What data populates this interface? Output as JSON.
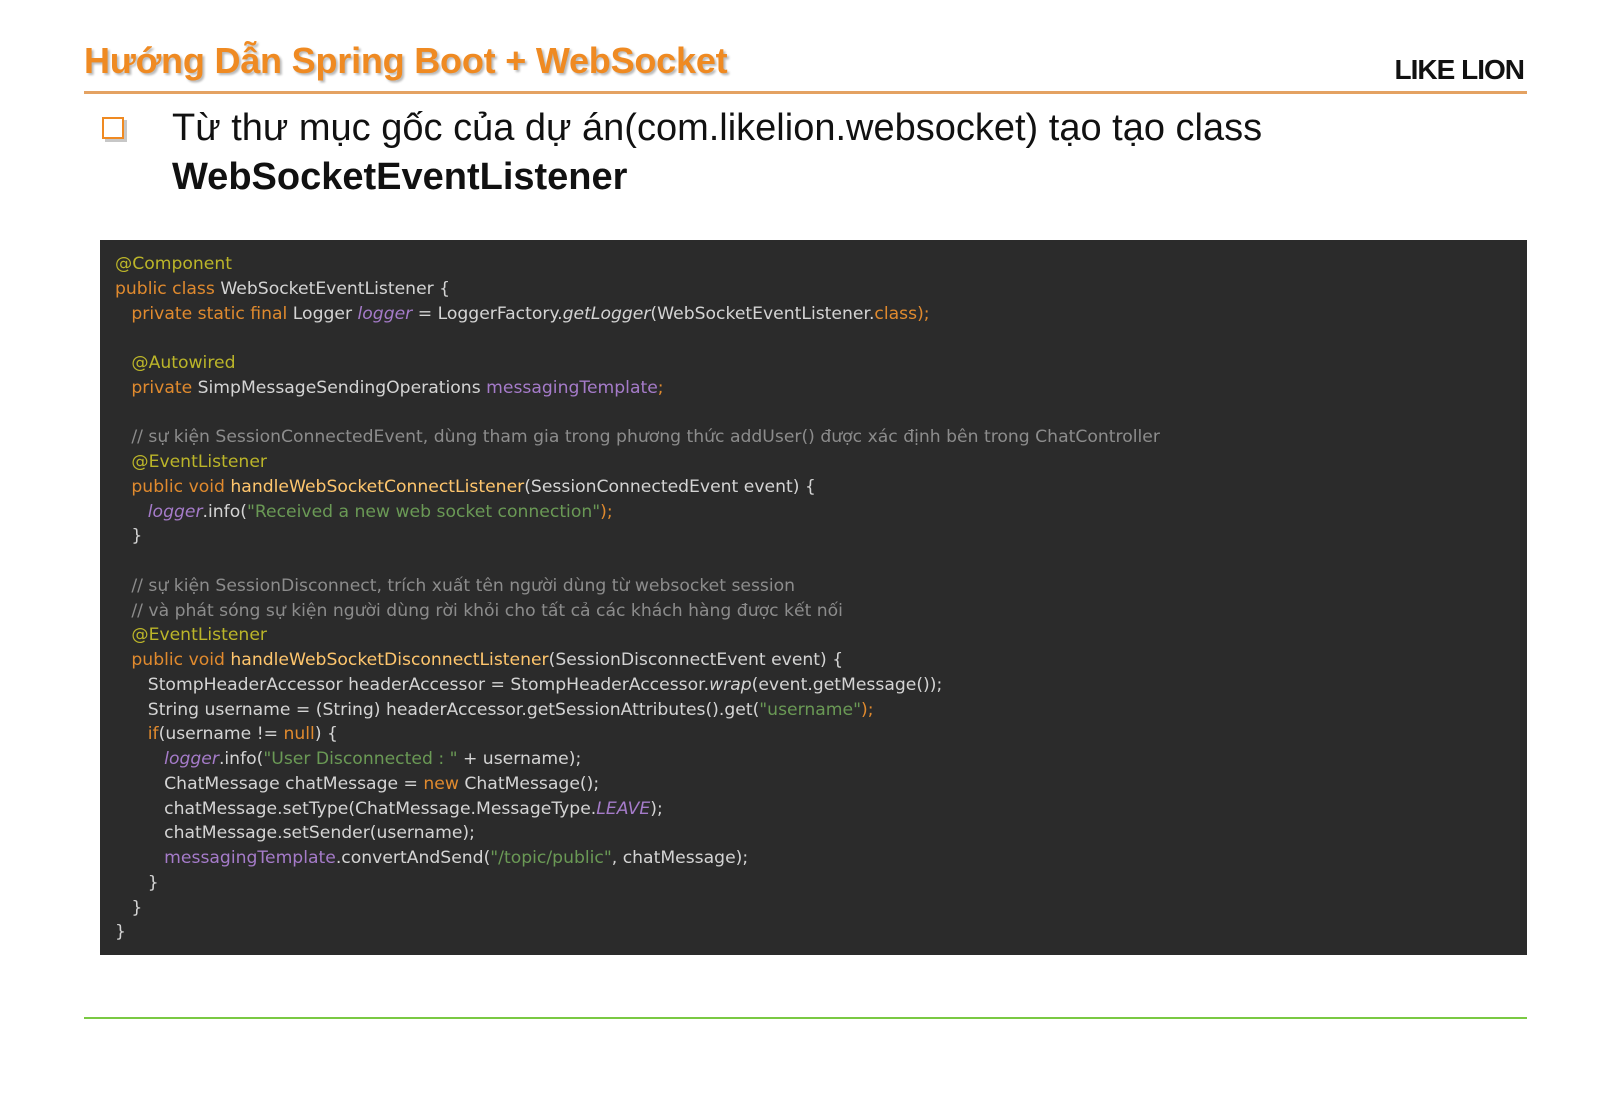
{
  "header": {
    "title": "Hướng Dẫn Spring Boot + WebSocket",
    "brand": "LIKE LION"
  },
  "bullet": {
    "text_line1": "Từ thư mục gốc của dự án(com.likelion.websocket) tạo tạo class",
    "text_line2": "WebSocketEventListener"
  },
  "code": {
    "l01": {
      "ann": "@Component"
    },
    "l02": {
      "kw": "public class ",
      "rest": "WebSocketEventListener {"
    },
    "l03": {
      "indent": "   ",
      "kw": "private static final ",
      "t1": "Logger ",
      "fd": "logger",
      "t2": " = LoggerFactory.",
      "it": "getLogger",
      "t3": "(WebSocketEventListener.",
      "kw2": "class",
      "t4": ");"
    },
    "l04": {
      "text": ""
    },
    "l05": {
      "indent": "   ",
      "ann": "@Autowired"
    },
    "l06": {
      "indent": "   ",
      "kw": "private ",
      "t1": "SimpMessageSendingOperations ",
      "fd": "messagingTemplate",
      "t2": ";"
    },
    "l07": {
      "text": ""
    },
    "l08": {
      "indent": "   ",
      "cm": "// sự kiện SessionConnectedEvent, dùng tham gia trong phương thức addUser() được xác định bên trong ChatController"
    },
    "l09": {
      "indent": "   ",
      "ann": "@EventListener"
    },
    "l10": {
      "indent": "   ",
      "kw": "public void ",
      "mth": "handleWebSocketConnectListener",
      "t1": "(SessionConnectedEvent event) {"
    },
    "l11": {
      "indent": "      ",
      "fd": "logger",
      "t1": ".info(",
      "str": "\"Received a new web socket connection\"",
      "t2": ");"
    },
    "l12": {
      "indent": "   ",
      "t1": "}"
    },
    "l13": {
      "text": ""
    },
    "l14": {
      "indent": "   ",
      "cm": "// sự kiện SessionDisconnect, trích xuất tên người dùng từ websocket session"
    },
    "l15": {
      "indent": "   ",
      "cm": "// và phát sóng sự kiện người dùng rời khỏi cho tất cả các khách hàng được kết nối"
    },
    "l16": {
      "indent": "   ",
      "ann": "@EventListener"
    },
    "l17": {
      "indent": "   ",
      "kw": "public void ",
      "mth": "handleWebSocketDisconnectListener",
      "t1": "(SessionDisconnectEvent event) {"
    },
    "l18": {
      "indent": "      ",
      "t1": "StompHeaderAccessor headerAccessor = StompHeaderAccessor.",
      "it": "wrap",
      "t2": "(event.getMessage());"
    },
    "l19": {
      "indent": "      ",
      "t1": "String username = (String) headerAccessor.getSessionAttributes().get(",
      "str": "\"username\"",
      "t2": ");"
    },
    "l20": {
      "indent": "      ",
      "kw": "if",
      "t1": "(username != ",
      "kw2": "null",
      "t2": ") {"
    },
    "l21": {
      "indent": "         ",
      "fd": "logger",
      "t1": ".info(",
      "str": "\"User Disconnected : \"",
      "t2": " + username);"
    },
    "l22": {
      "indent": "         ",
      "t1": "ChatMessage chatMessage = ",
      "kw": "new ",
      "t2": "ChatMessage();"
    },
    "l23": {
      "indent": "         ",
      "t1": "chatMessage.setType(ChatMessage.MessageType.",
      "fd": "LEAVE",
      "t2": ");"
    },
    "l24": {
      "indent": "         ",
      "t1": "chatMessage.setSender(username);"
    },
    "l25": {
      "indent": "         ",
      "fd": "messagingTemplate",
      "t1": ".convertAndSend(",
      "str": "\"/topic/public\"",
      "t2": ", chatMessage);"
    },
    "l26": {
      "indent": "      ",
      "t1": "}"
    },
    "l27": {
      "indent": "   ",
      "t1": "}"
    },
    "l28": {
      "t1": "}"
    }
  }
}
